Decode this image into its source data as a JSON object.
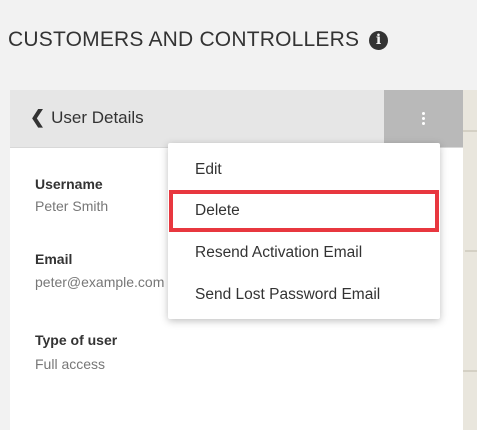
{
  "header": {
    "title": "CUSTOMERS AND CONTROLLERS",
    "info_icon": "info-icon"
  },
  "panel": {
    "back_label": "User Details",
    "back_icon": "chevron-left-icon",
    "menu_icon": "kebab-menu-icon",
    "fields": [
      {
        "label": "Username",
        "value": "Peter Smith"
      },
      {
        "label": "Email",
        "value": "peter@example.com"
      },
      {
        "label": "Type of user",
        "value": "Full access"
      }
    ]
  },
  "menu": {
    "items": [
      {
        "label": "Edit"
      },
      {
        "label": "Delete"
      },
      {
        "label": "Resend Activation Email"
      },
      {
        "label": "Send Lost Password Email"
      }
    ],
    "highlighted_item": "Delete",
    "highlight_color": "#e8373f"
  }
}
